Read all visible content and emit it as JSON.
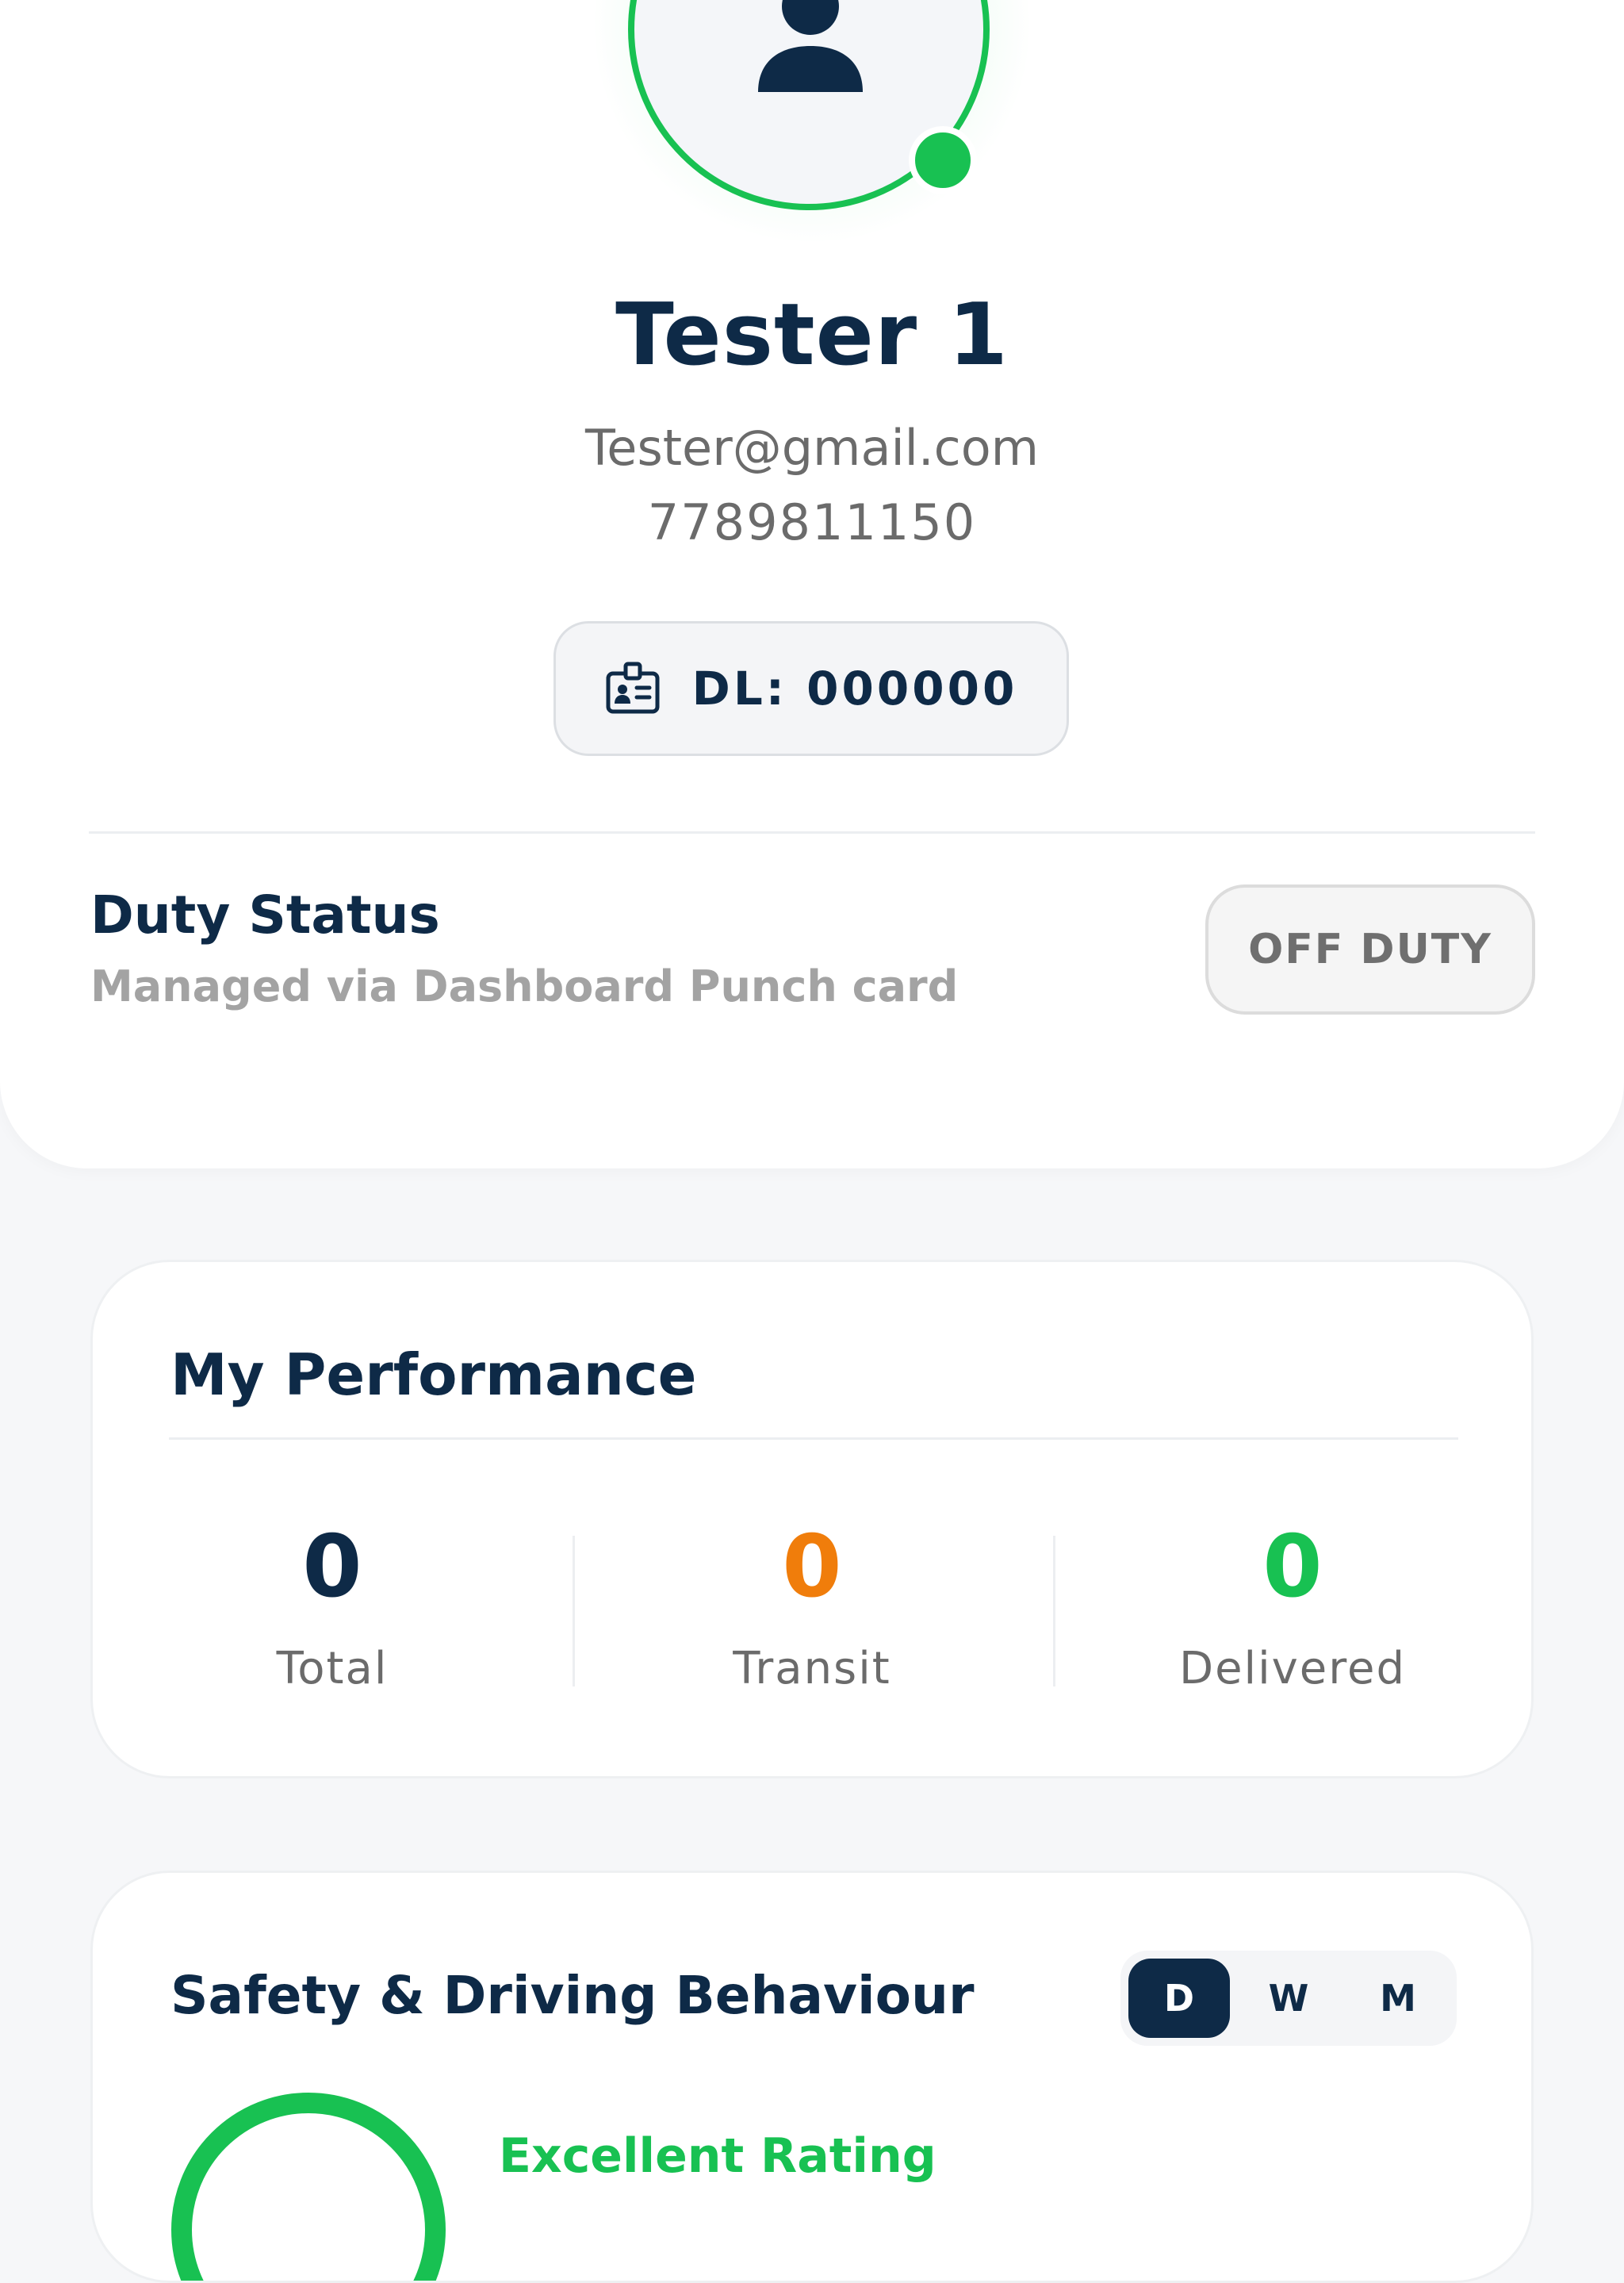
{
  "profile": {
    "name": "Tester 1",
    "email": "Tester@gmail.com",
    "phone": "7789811150",
    "dl_label": "DL: 000000",
    "online_status_color": "#18c152"
  },
  "duty": {
    "title": "Duty Status",
    "subtitle": "Managed via Dashboard Punch card",
    "status_button": "OFF DUTY"
  },
  "performance": {
    "title": "My Performance",
    "stats": [
      {
        "value": "0",
        "label": "Total",
        "color": "#0e2a47"
      },
      {
        "value": "0",
        "label": "Transit",
        "color": "#f07d0b"
      },
      {
        "value": "0",
        "label": "Delivered",
        "color": "#18c152"
      }
    ]
  },
  "safety": {
    "title": "Safety & Driving Behaviour",
    "periods": [
      "D",
      "W",
      "M"
    ],
    "selected_period": "D",
    "rating_label": "Excellent Rating"
  },
  "icons": {
    "avatar": "user-icon",
    "dl": "id-card-icon"
  },
  "colors": {
    "primary": "#0e2a47",
    "success": "#18c152",
    "warning": "#f07d0b"
  }
}
